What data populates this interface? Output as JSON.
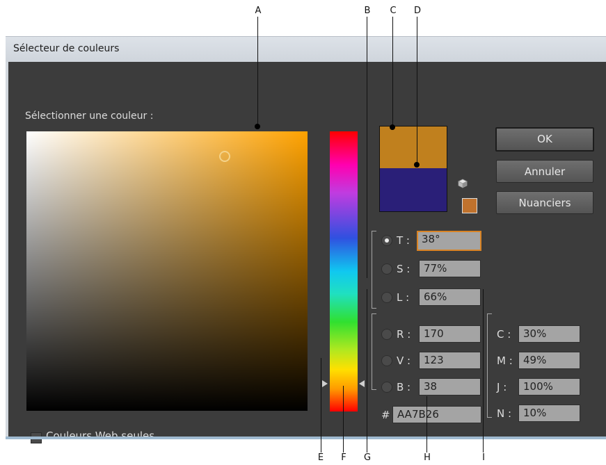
{
  "callouts": {
    "A": "A",
    "B": "B",
    "C": "C",
    "D": "D",
    "E": "E",
    "F": "F",
    "G": "G",
    "H": "H",
    "I": "I"
  },
  "dialog": {
    "title": "Sélecteur de couleurs",
    "select_label": "Sélectionner une couleur :",
    "buttons": {
      "ok": "OK",
      "cancel": "Annuler",
      "swatches": "Nuanciers"
    },
    "hsb": {
      "t_label": "T :",
      "t_value": "38°",
      "s_label": "S :",
      "s_value": "77%",
      "l_label": "L :",
      "l_value": "66%",
      "selected": "T"
    },
    "rgb": {
      "r_label": "R :",
      "r_value": "170",
      "v_label": "V :",
      "v_value": "123",
      "b_label": "B :",
      "b_value": "38"
    },
    "hex": {
      "label": "#",
      "value": "AA7B26"
    },
    "cmyk": {
      "c_label": "C :",
      "c_value": "30%",
      "m_label": "M :",
      "m_value": "49%",
      "j_label": "J :",
      "j_value": "100%",
      "n_label": "N :",
      "n_value": "10%"
    },
    "web_only_label": "Couleurs Web seules",
    "web_only_checked": false,
    "colors": {
      "new_color": "#c0801e",
      "original_color": "#2a1f78",
      "web_safe_swatch": "#c0722d",
      "focus_accent": "#d98324"
    },
    "icons": {
      "gamut_warning": "cube-icon"
    }
  }
}
